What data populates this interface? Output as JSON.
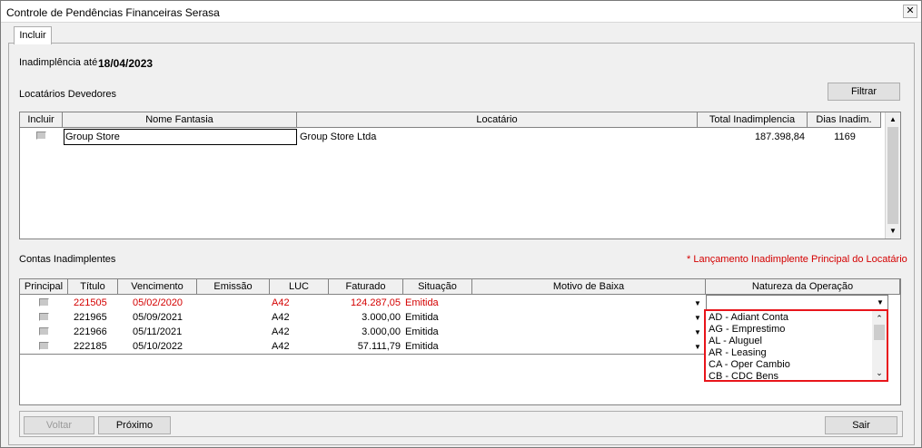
{
  "window": {
    "title": "Controle de Pendências Financeiras Serasa",
    "close_glyph": "✕"
  },
  "tabs": [
    {
      "label": "Incluir"
    }
  ],
  "inadimplencia": {
    "label": "Inadimplência até",
    "date": "18/04/2023"
  },
  "devedores": {
    "section_label": "Locatários Devedores",
    "filter_button": "Filtrar",
    "columns": [
      "Incluir",
      "Nome Fantasia",
      "Locatário",
      "Total Inadimplencia",
      "Dias Inadim."
    ],
    "rows": [
      {
        "nome_fantasia": "Group Store",
        "locatario": "Group Store Ltda",
        "total": "187.398,84",
        "dias": "1169"
      }
    ]
  },
  "contas": {
    "section_label": "Contas Inadimplentes",
    "legend_note": "* Lançamento Inadimplente Principal do Locatário",
    "columns": [
      "Principal",
      "Título",
      "Vencimento",
      "Emissão",
      "LUC",
      "Faturado",
      "Situação",
      "Motivo de Baixa",
      "Natureza da Operação"
    ],
    "rows": [
      {
        "titulo": "221505",
        "vencimento": "05/02/2020",
        "emissao": "",
        "luc": "A42",
        "faturado": "124.287,05",
        "situacao": "Emitida",
        "highlight": true
      },
      {
        "titulo": "221965",
        "vencimento": "05/09/2021",
        "emissao": "",
        "luc": "A42",
        "faturado": "3.000,00",
        "situacao": "Emitida",
        "highlight": false
      },
      {
        "titulo": "221966",
        "vencimento": "05/11/2021",
        "emissao": "",
        "luc": "A42",
        "faturado": "3.000,00",
        "situacao": "Emitida",
        "highlight": false
      },
      {
        "titulo": "222185",
        "vencimento": "05/10/2022",
        "emissao": "",
        "luc": "A42",
        "faturado": "57.111,79",
        "situacao": "Emitida",
        "highlight": false
      }
    ],
    "natureza_options": [
      "AD - Adiant Conta",
      "AG - Emprestimo",
      "AL - Aluguel",
      "AR - Leasing",
      "CA - Oper Cambio",
      "CB - CDC Bens"
    ]
  },
  "footer": {
    "voltar": "Voltar",
    "proximo": "Próximo",
    "sair": "Sair"
  },
  "colors": {
    "accent_red": "#d40000",
    "dropdown_border": "#e8151b"
  }
}
